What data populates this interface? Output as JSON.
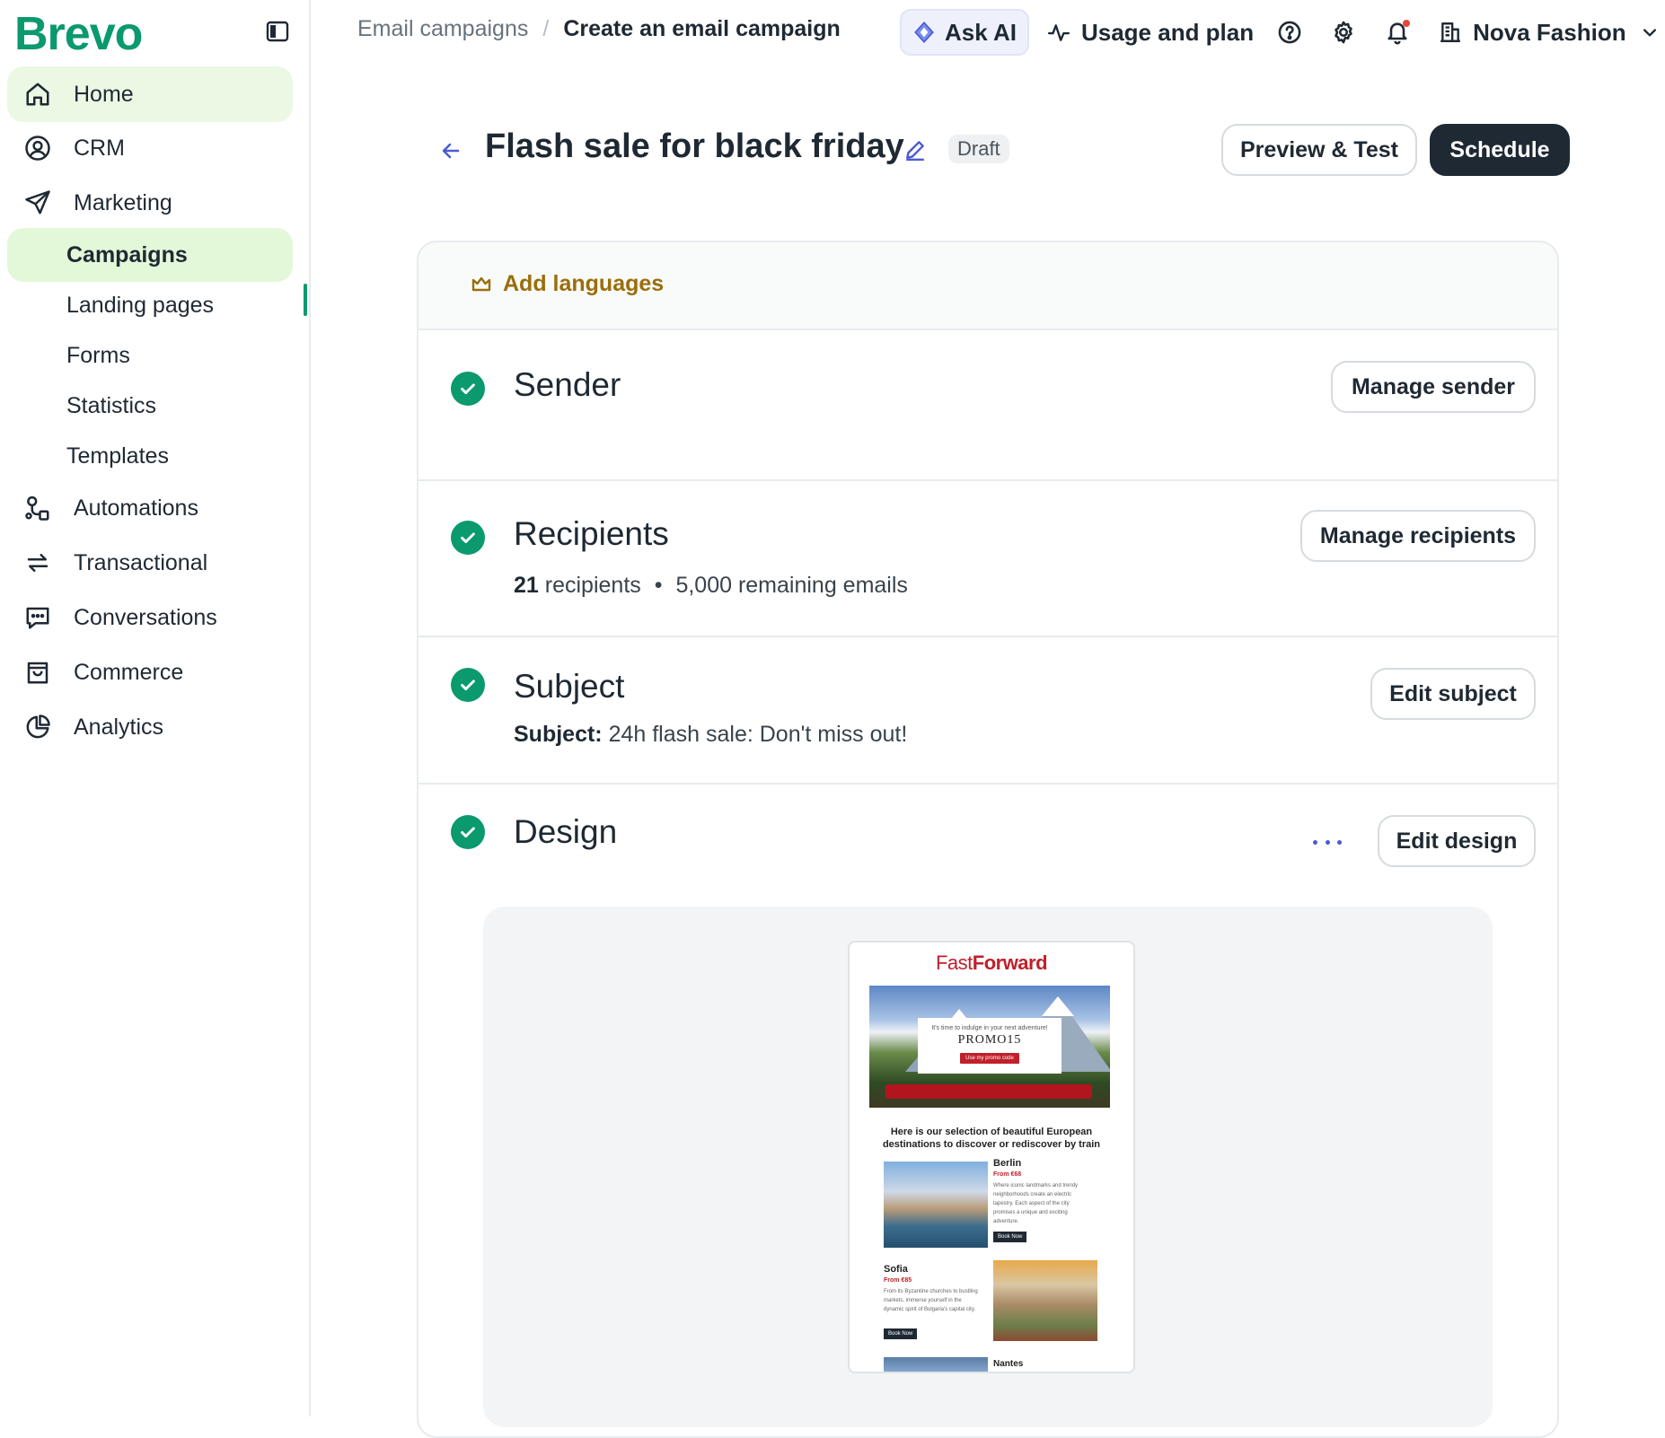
{
  "sidebar": {
    "logo": "Brevo",
    "items": [
      {
        "label": "Home"
      },
      {
        "label": "CRM"
      },
      {
        "label": "Marketing"
      },
      {
        "label": "Automations"
      },
      {
        "label": "Transactional"
      },
      {
        "label": "Conversations"
      },
      {
        "label": "Commerce"
      },
      {
        "label": "Analytics"
      }
    ],
    "marketing_sub": [
      {
        "label": "Campaigns"
      },
      {
        "label": "Landing pages"
      },
      {
        "label": "Forms"
      },
      {
        "label": "Statistics"
      },
      {
        "label": "Templates"
      }
    ]
  },
  "breadcrumb": {
    "parent": "Email campaigns",
    "separator": "/",
    "current": "Create an email campaign"
  },
  "topbar": {
    "ask_ai": "Ask AI",
    "usage": "Usage and plan",
    "account": "Nova Fashion"
  },
  "header": {
    "title": "Flash sale for black friday",
    "status": "Draft",
    "preview_btn": "Preview & Test",
    "schedule_btn": "Schedule"
  },
  "card": {
    "add_languages": "Add languages",
    "sections": {
      "sender": {
        "title": "Sender",
        "button": "Manage sender"
      },
      "recipients": {
        "title": "Recipients",
        "count": "21",
        "count_label": "recipients",
        "bullet": "•",
        "remaining": "5,000 remaining emails",
        "button": "Manage recipients"
      },
      "subject": {
        "title": "Subject",
        "label": "Subject:",
        "value": "24h flash sale: Don't miss out!",
        "button": "Edit subject"
      },
      "design": {
        "title": "Design",
        "button": "Edit design"
      }
    }
  },
  "email_preview": {
    "brand_light": "Fast",
    "brand_bold": "Forward",
    "promo_small": "It's time to indulge in your next adventure!",
    "promo_code": "PROMO15",
    "promo_button": "Use my promo code",
    "intro": "Here is our selection of beautiful European destinations to discover or rediscover by train",
    "destinations": [
      {
        "name": "Berlin",
        "price": "From €68",
        "desc": "Where iconic landmarks and trendy neighborhoods create an electric tapestry. Each aspect of the city promises a unique and exciting adventure.",
        "button": "Book Now"
      },
      {
        "name": "Sofia",
        "price": "From €85",
        "desc": "From its Byzantine churches to bustling markets, immerse yourself in the dynamic spirit of Bulgaria's capital city.",
        "button": "Book Now"
      },
      {
        "name": "Nantes"
      }
    ]
  },
  "colors": {
    "brand_green": "#0b996e",
    "active_bg": "#e3f8d9",
    "dark_button": "#1f2933",
    "add_languages": "#9a6e0a",
    "email_red": "#c0202a"
  },
  "icons": [
    "sidebar-toggle-icon",
    "home-icon",
    "user-circle-icon",
    "send-icon",
    "automation-icon",
    "arrows-exchange-icon",
    "chat-icon",
    "shopping-bag-icon",
    "pie-chart-icon",
    "diamond-sparkle-icon",
    "activity-icon",
    "help-icon",
    "gear-icon",
    "bell-icon",
    "building-icon",
    "chevron-down-icon",
    "arrow-left-icon",
    "pencil-icon",
    "crown-icon",
    "check-icon",
    "more-dots-icon"
  ]
}
